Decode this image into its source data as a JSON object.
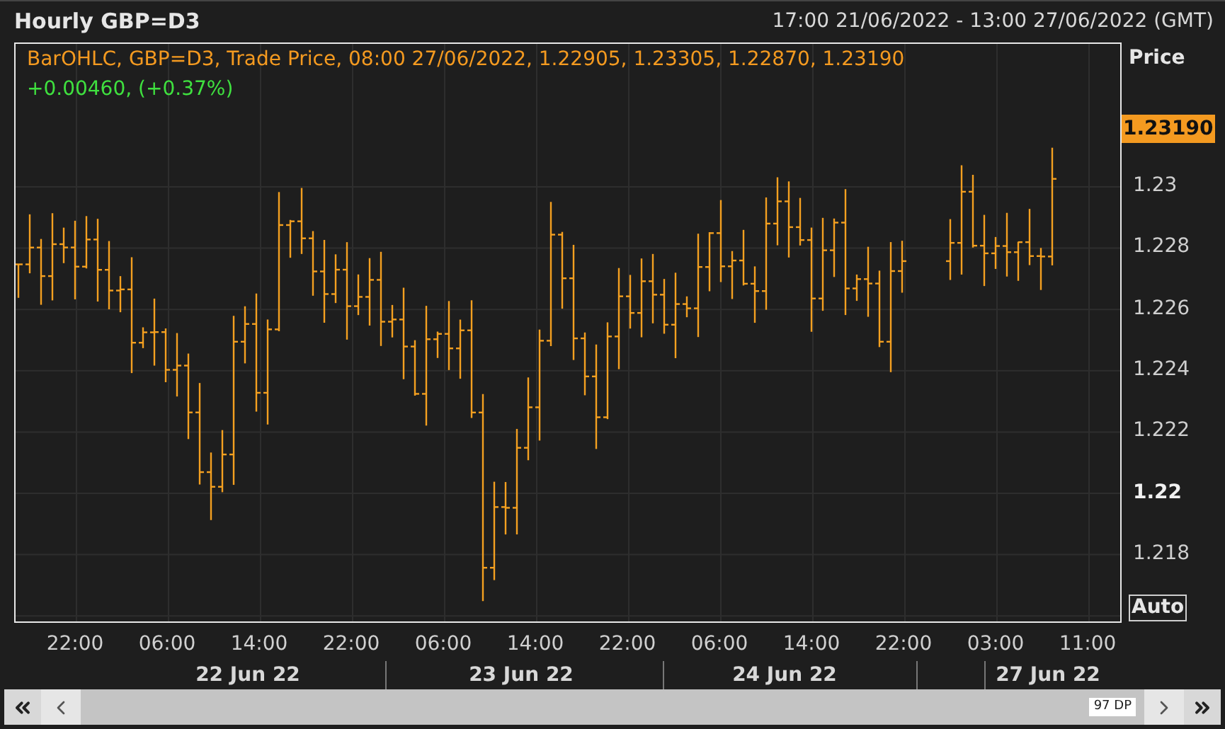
{
  "header": {
    "title": "Hourly GBP=D3",
    "range": "17:00 21/06/2022 - 13:00 27/06/2022 (GMT)"
  },
  "legend": {
    "description": "BarOHLC, GBP=D3, Trade Price, 08:00 27/06/2022, 1.22905, 1.23305, 1.22870, 1.23190",
    "change": "+0.00460, (+0.37%)"
  },
  "price_axis": {
    "title": "Price",
    "last_price": "1.23190",
    "ticks": [
      {
        "label": "1.23",
        "emphasized": false
      },
      {
        "label": "1.228",
        "emphasized": false
      },
      {
        "label": "1.226",
        "emphasized": false
      },
      {
        "label": "1.224",
        "emphasized": false
      },
      {
        "label": "1.222",
        "emphasized": false
      },
      {
        "label": "1.22",
        "emphasized": true
      },
      {
        "label": "1.218",
        "emphasized": false
      }
    ],
    "auto_button": "Auto"
  },
  "time_axis": {
    "times": [
      "22:00",
      "06:00",
      "14:00",
      "22:00",
      "06:00",
      "14:00",
      "22:00",
      "06:00",
      "14:00",
      "22:00",
      "03:00",
      "11:00"
    ],
    "dates": [
      "22 Jun 22",
      "23 Jun 22",
      "24 Jun 22",
      "27 Jun 22"
    ]
  },
  "scrollbar": {
    "data_points": "97 DP"
  }
}
